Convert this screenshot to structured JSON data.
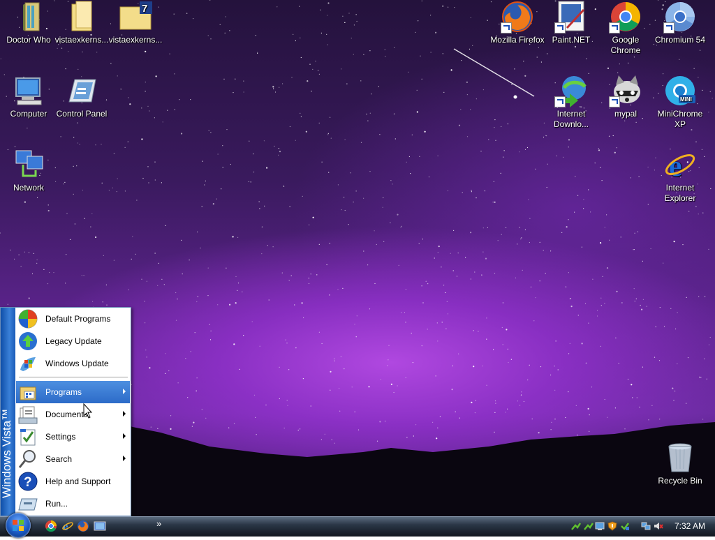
{
  "desktop": {
    "icons_left": [
      {
        "label": "Doctor Who"
      },
      {
        "label": "vistaexkerns..."
      },
      {
        "label": "vistaexkerns..."
      },
      {
        "label": "Computer"
      },
      {
        "label": "Control Panel"
      },
      {
        "label": "Network"
      }
    ],
    "icons_right": [
      {
        "label": "Mozilla Firefox"
      },
      {
        "label": "Paint.NET"
      },
      {
        "label": "Google Chrome"
      },
      {
        "label": "Chromium 54"
      },
      {
        "label": "Internet Downlo..."
      },
      {
        "label": "mypal"
      },
      {
        "label": "MiniChrome XP"
      },
      {
        "label": "Internet Explorer"
      },
      {
        "label": "Recycle Bin"
      }
    ]
  },
  "start_menu": {
    "brand": "Windows Vista™",
    "items": [
      {
        "label": "Default Programs",
        "icon": "default-programs-icon",
        "submenu": false
      },
      {
        "label": "Legacy Update",
        "icon": "legacy-update-icon",
        "submenu": false
      },
      {
        "label": "Windows Update",
        "icon": "windows-update-icon",
        "submenu": false
      },
      {
        "label": "Programs",
        "icon": "programs-icon",
        "submenu": true,
        "active": true
      },
      {
        "label": "Documents",
        "icon": "documents-icon",
        "submenu": true
      },
      {
        "label": "Settings",
        "icon": "settings-icon",
        "submenu": true
      },
      {
        "label": "Search",
        "icon": "search-icon",
        "submenu": true
      },
      {
        "label": "Help and Support",
        "icon": "help-icon",
        "submenu": false
      },
      {
        "label": "Run...",
        "icon": "run-icon",
        "submenu": false
      }
    ]
  },
  "taskbar": {
    "quick_launch": [
      "chrome-icon",
      "internet-explorer-icon",
      "firefox-icon",
      "show-desktop-icon"
    ],
    "more": "»",
    "tray_icons": [
      "network-icon",
      "network-icon",
      "display-icon",
      "security-shield-icon",
      "update-icon",
      "connection-icon",
      "volume-muted-icon"
    ],
    "clock": "7:32 AM"
  },
  "colors": {
    "highlight": "#2c6bc8",
    "brand_bar": "#1a5bb8",
    "taskbar": "#1b2330"
  }
}
